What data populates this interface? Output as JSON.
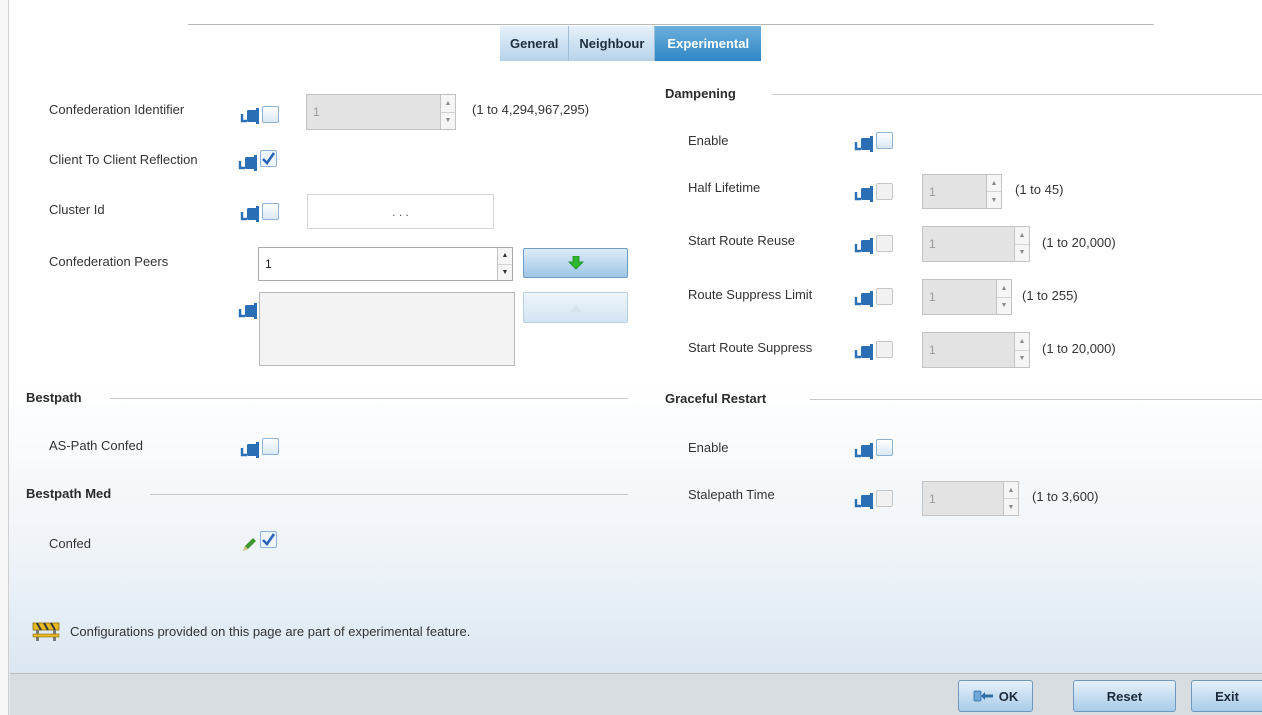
{
  "tabs": [
    {
      "label": "General",
      "active": false
    },
    {
      "label": "Neighbour",
      "active": false
    },
    {
      "label": "Experimental",
      "active": true
    }
  ],
  "left": {
    "confederation_identifier": {
      "label": "Confederation Identifier",
      "value": "1",
      "range": "(1 to 4,294,967,295)"
    },
    "client_to_client_reflection": {
      "label": "Client To Client Reflection",
      "checked": true
    },
    "cluster_id": {
      "label": "Cluster Id",
      "value": ". . ."
    },
    "confederation_peers": {
      "label": "Confederation Peers",
      "value": "1"
    },
    "bestpath": {
      "title": "Bestpath",
      "as_path_confed": {
        "label": "AS-Path Confed",
        "checked": false
      }
    },
    "bestpath_med": {
      "title": "Bestpath Med",
      "confed": {
        "label": "Confed",
        "checked": true
      }
    }
  },
  "right": {
    "dampening": {
      "title": "Dampening",
      "enable": {
        "label": "Enable",
        "checked": false
      },
      "half_lifetime": {
        "label": "Half Lifetime",
        "value": "1",
        "range": "(1 to 45)"
      },
      "start_route_reuse": {
        "label": "Start Route Reuse",
        "value": "1",
        "range": "(1 to 20,000)"
      },
      "route_suppress_limit": {
        "label": "Route Suppress Limit",
        "value": "1",
        "range": "(1 to 255)"
      },
      "start_route_suppress": {
        "label": "Start Route Suppress",
        "value": "1",
        "range": "(1 to 20,000)"
      }
    },
    "graceful_restart": {
      "title": "Graceful Restart",
      "enable": {
        "label": "Enable",
        "checked": false
      },
      "stalepath_time": {
        "label": "Stalepath Time",
        "value": "1",
        "range": "(1 to 3,600)"
      }
    }
  },
  "notice": {
    "text": "Configurations provided on this page are part of experimental feature.",
    "icon": "roadwork-barrier-icon"
  },
  "footer": {
    "ok": "OK",
    "reset": "Reset",
    "exit": "Exit"
  },
  "colors": {
    "accent": "#2f86c6",
    "pin": "#2a6fb5",
    "check": "#2b63b8",
    "edit": "#3e9a2e",
    "arrow_green": "#2eb82e"
  }
}
